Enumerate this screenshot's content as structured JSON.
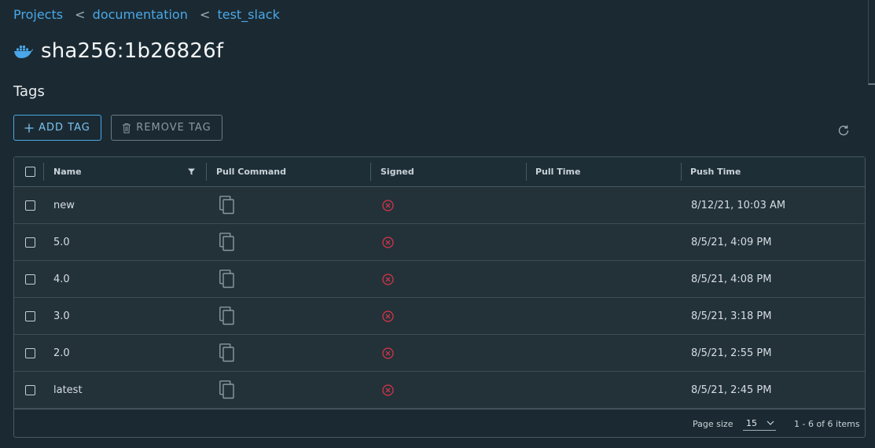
{
  "breadcrumb": {
    "items": [
      "Projects",
      "documentation",
      "test_slack"
    ],
    "separator": "<"
  },
  "artifact": {
    "title": "sha256:1b26826f",
    "icon": "docker-icon"
  },
  "tags_section": {
    "title": "Tags",
    "add_label": "ADD TAG",
    "remove_label": "REMOVE TAG"
  },
  "table": {
    "columns": {
      "name": "Name",
      "pull_command": "Pull Command",
      "signed": "Signed",
      "pull_time": "Pull Time",
      "push_time": "Push Time"
    },
    "rows": [
      {
        "name": "new",
        "signed": false,
        "pull_time": "",
        "push_time": "8/12/21, 10:03 AM"
      },
      {
        "name": "5.0",
        "signed": false,
        "pull_time": "",
        "push_time": "8/5/21, 4:09 PM"
      },
      {
        "name": "4.0",
        "signed": false,
        "pull_time": "",
        "push_time": "8/5/21, 4:08 PM"
      },
      {
        "name": "3.0",
        "signed": false,
        "pull_time": "",
        "push_time": "8/5/21, 3:18 PM"
      },
      {
        "name": "2.0",
        "signed": false,
        "pull_time": "",
        "push_time": "8/5/21, 2:55 PM"
      },
      {
        "name": "latest",
        "signed": false,
        "pull_time": "",
        "push_time": "8/5/21, 2:45 PM"
      }
    ]
  },
  "footer": {
    "page_size_label": "Page size",
    "page_size_value": "15",
    "item_count": "1 - 6 of 6 items"
  },
  "colors": {
    "accent": "#4aa7e8",
    "unsigned": "#e0344a",
    "background": "#1b2a32"
  }
}
